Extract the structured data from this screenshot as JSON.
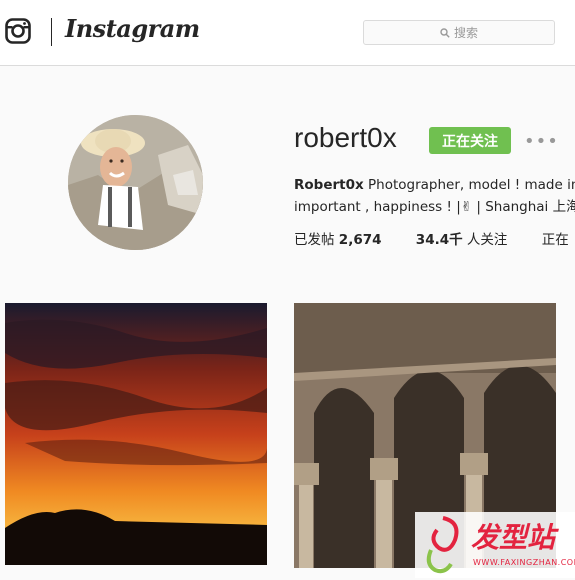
{
  "header": {
    "brand": "Instagram",
    "search_placeholder": "搜索"
  },
  "profile": {
    "username": "robert0x",
    "follow_label": "正在关注",
    "more_label": "•••",
    "display_name": "Robert0x",
    "bio_line1": "Photographer, model ! made in H",
    "bio_line2": "important , happiness ! |✌ | Shanghai 上海 |",
    "stats": {
      "posts_label": "已发帖",
      "posts_value": "2,674",
      "followers_value": "34.4千",
      "followers_label": "人关注",
      "following_label": "正在"
    }
  },
  "watermark": {
    "text": "发型站",
    "url": "WWW.FAXINGZHAN.COM"
  }
}
